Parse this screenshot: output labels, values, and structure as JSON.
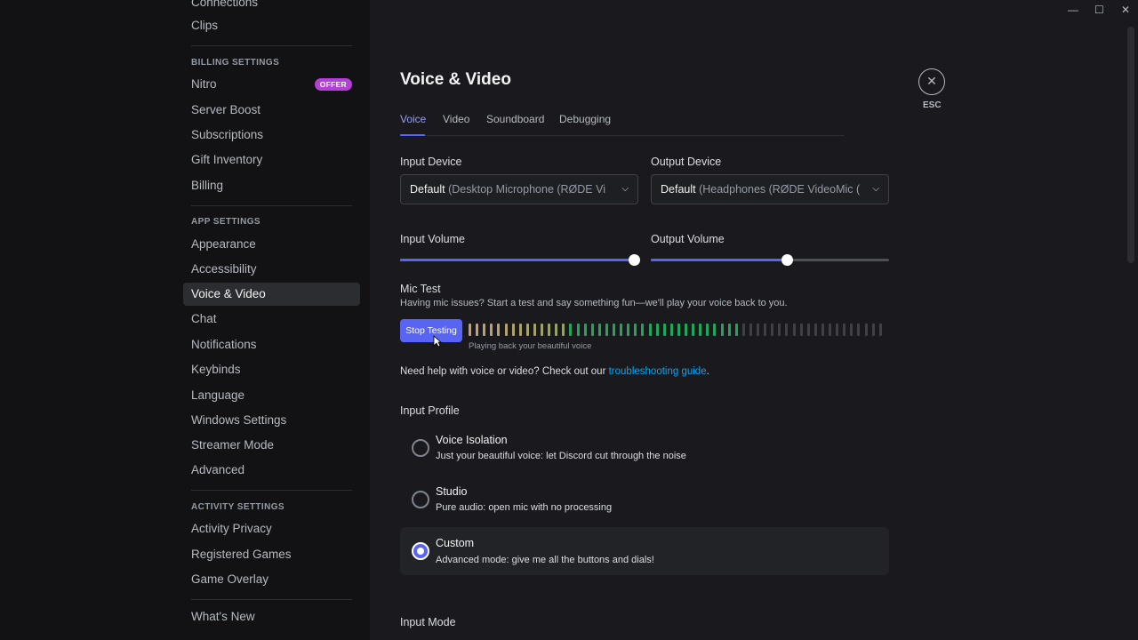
{
  "sidebar": {
    "items_top": [
      {
        "label": "Connections",
        "y": -6
      },
      {
        "label": "Clips",
        "y": 16
      }
    ],
    "billing_header": "BILLING SETTINGS",
    "billing_items": [
      {
        "label": "Nitro"
      },
      {
        "label": "Server Boost"
      },
      {
        "label": "Subscriptions"
      },
      {
        "label": "Gift Inventory"
      },
      {
        "label": "Billing"
      }
    ],
    "offer_badge": "OFFER",
    "app_header": "APP SETTINGS",
    "app_items": [
      {
        "label": "Appearance"
      },
      {
        "label": "Accessibility"
      },
      {
        "label": "Voice & Video"
      },
      {
        "label": "Chat"
      },
      {
        "label": "Notifications"
      },
      {
        "label": "Keybinds"
      },
      {
        "label": "Language"
      },
      {
        "label": "Windows Settings"
      },
      {
        "label": "Streamer Mode"
      },
      {
        "label": "Advanced"
      }
    ],
    "activity_header": "ACTIVITY SETTINGS",
    "activity_items": [
      {
        "label": "Activity Privacy"
      },
      {
        "label": "Registered Games"
      },
      {
        "label": "Game Overlay"
      }
    ],
    "whats_new": "What's New"
  },
  "page": {
    "title": "Voice & Video",
    "tabs": [
      "Voice",
      "Video",
      "Soundboard",
      "Debugging"
    ],
    "active_tab": "Voice",
    "close_label": "ESC"
  },
  "devices": {
    "input_label": "Input Device",
    "input_value_main": "Default",
    "input_value_muted": "(Desktop Microphone (RØDE Vi",
    "output_label": "Output Device",
    "output_value_main": "Default",
    "output_value_muted": "(Headphones (RØDE VideoMic (",
    "input_volume_label": "Input Volume",
    "input_volume": 0.98,
    "output_volume_label": "Output Volume",
    "output_volume": 0.57
  },
  "mic_test": {
    "title": "Mic Test",
    "description": "Having mic issues? Start a test and say something fun—we'll play your voice back to you.",
    "button_label": "Stop Testing",
    "playback_text": "Playing back your beautiful voice",
    "level_active_bars": 38,
    "level_total_bars": 58
  },
  "help": {
    "text_before": "Need help with voice or video? Check out our ",
    "link_text": "troubleshooting guide",
    "text_after": "."
  },
  "input_profile": {
    "title": "Input Profile",
    "options": [
      {
        "title": "Voice Isolation",
        "desc": "Just your beautiful voice: let Discord cut through the noise",
        "selected": false
      },
      {
        "title": "Studio",
        "desc": "Pure audio: open mic with no processing",
        "selected": false
      },
      {
        "title": "Custom",
        "desc": "Advanced mode: give me all the buttons and dials!",
        "selected": true
      }
    ]
  },
  "input_mode": {
    "title": "Input Mode"
  },
  "colors": {
    "accent": "#5865f2",
    "offer": "#b43fd6",
    "link": "#00a8fc",
    "meter_green": "#23a559"
  }
}
